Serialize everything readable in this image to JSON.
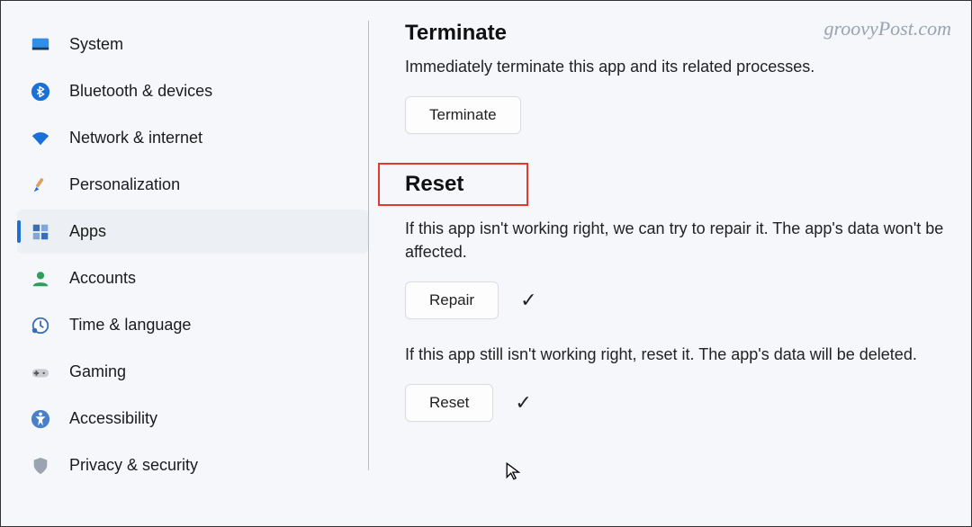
{
  "watermark": "groovyPost.com",
  "sidebar": {
    "items": [
      {
        "label": "System",
        "icon": "system-icon"
      },
      {
        "label": "Bluetooth & devices",
        "icon": "bluetooth-icon"
      },
      {
        "label": "Network & internet",
        "icon": "wifi-icon"
      },
      {
        "label": "Personalization",
        "icon": "brush-icon"
      },
      {
        "label": "Apps",
        "icon": "apps-icon"
      },
      {
        "label": "Accounts",
        "icon": "accounts-icon"
      },
      {
        "label": "Time & language",
        "icon": "time-icon"
      },
      {
        "label": "Gaming",
        "icon": "gaming-icon"
      },
      {
        "label": "Accessibility",
        "icon": "accessibility-icon"
      },
      {
        "label": "Privacy & security",
        "icon": "privacy-icon"
      }
    ],
    "selected_index": 4
  },
  "content": {
    "terminate": {
      "heading": "Terminate",
      "description": "Immediately terminate this app and its related processes.",
      "button": "Terminate"
    },
    "reset": {
      "heading": "Reset",
      "repair_description": "If this app isn't working right, we can try to repair it. The app's data won't be affected.",
      "repair_button": "Repair",
      "reset_description": "If this app still isn't working right, reset it. The app's data will be deleted.",
      "reset_button": "Reset"
    }
  }
}
